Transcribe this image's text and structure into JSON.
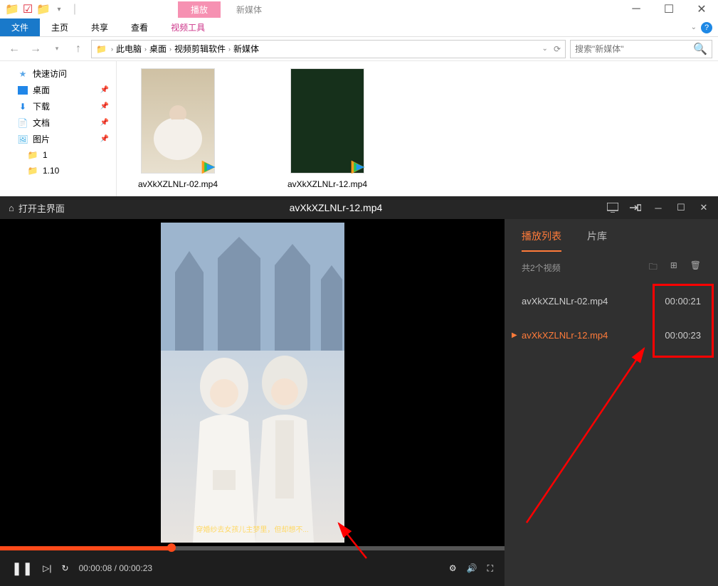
{
  "explorer": {
    "play_tab": "播放",
    "new_media": "新媒体",
    "ribbon": {
      "file": "文件",
      "home": "主页",
      "share": "共享",
      "view": "查看",
      "video_tools": "视频工具"
    },
    "breadcrumb": [
      "此电脑",
      "桌面",
      "视频剪辑软件",
      "新媒体"
    ],
    "search_placeholder": "搜索\"新媒体\"",
    "nav": {
      "quick": "快速访问",
      "desktop": "桌面",
      "downloads": "下载",
      "documents": "文档",
      "pictures": "图片",
      "folder1": "1",
      "folder110": "1.10"
    },
    "files": [
      {
        "name": "avXkXZLNLr-02.mp4"
      },
      {
        "name": "avXkXZLNLr-12.mp4"
      }
    ]
  },
  "player": {
    "open_main": "打开主界面",
    "title": "avXkXZLNLr-12.mp4",
    "subtitle": "穿婚纱去女孩儿主梦里，但却想不...",
    "time_current": "00:00:08",
    "time_total": "00:00:23",
    "playlist": {
      "tab_list": "播放列表",
      "tab_lib": "片库",
      "count": "共2个视频",
      "items": [
        {
          "name": "avXkXZLNLr-02.mp4",
          "duration": "00:00:21",
          "playing": false
        },
        {
          "name": "avXkXZLNLr-12.mp4",
          "duration": "00:00:23",
          "playing": true
        }
      ]
    }
  }
}
